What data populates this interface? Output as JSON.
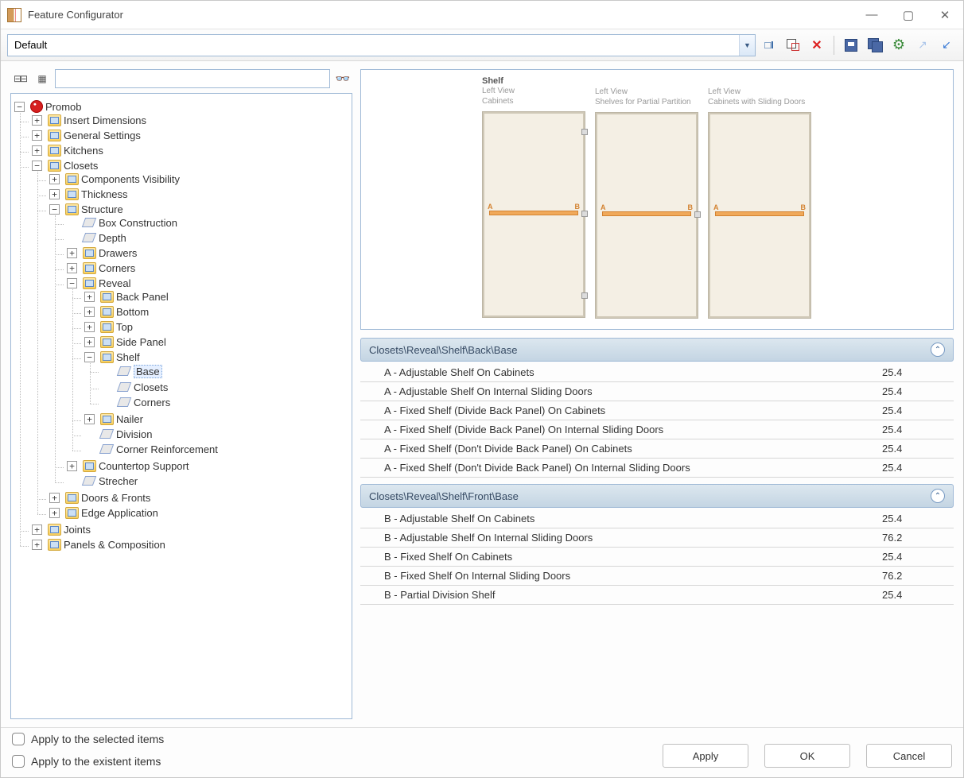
{
  "window": {
    "title": "Feature Configurator"
  },
  "toolbar": {
    "preset_value": "Default"
  },
  "search": {
    "placeholder": ""
  },
  "tree": {
    "root": "Promob",
    "items": {
      "insert_dimensions": "Insert Dimensions",
      "general_settings": "General Settings",
      "kitchens": "Kitchens",
      "closets": "Closets",
      "components_visibility": "Components Visibility",
      "thickness": "Thickness",
      "structure": "Structure",
      "box_construction": "Box Construction",
      "depth": "Depth",
      "drawers": "Drawers",
      "corners": "Corners",
      "reveal": "Reveal",
      "back_panel": "Back Panel",
      "bottom": "Bottom",
      "top": "Top",
      "side_panel": "Side Panel",
      "shelf": "Shelf",
      "base": "Base",
      "shelf_closets": "Closets",
      "shelf_corners": "Corners",
      "nailer": "Nailer",
      "division": "Division",
      "corner_reinforcement": "Corner Reinforcement",
      "countertop_support": "Countertop Support",
      "strecher": "Strecher",
      "doors_fronts": "Doors & Fronts",
      "edge_application": "Edge Application",
      "joints": "Joints",
      "panels_composition": "Panels & Composition"
    }
  },
  "preview": {
    "title": "Shelf",
    "col1_line1": "Left View",
    "col1_line2": "Cabinets",
    "col2_line1": "Left View",
    "col2_line2": "Shelves for Partial Partition",
    "col3_line1": "Left View",
    "col3_line2": "Cabinets with Sliding Doors"
  },
  "groups": [
    {
      "title": "Closets\\Reveal\\Shelf\\Back\\Base",
      "rows": [
        {
          "label": "A - Adjustable Shelf On Cabinets",
          "value": "25.4"
        },
        {
          "label": "A - Adjustable Shelf On Internal Sliding Doors",
          "value": "25.4"
        },
        {
          "label": "A - Fixed Shelf (Divide Back Panel) On Cabinets",
          "value": "25.4"
        },
        {
          "label": "A - Fixed Shelf (Divide Back Panel) On Internal Sliding Doors",
          "value": "25.4"
        },
        {
          "label": "A - Fixed Shelf (Don't Divide Back Panel) On Cabinets",
          "value": "25.4"
        },
        {
          "label": "A - Fixed Shelf (Don't Divide Back Panel) On Internal Sliding Doors",
          "value": "25.4"
        }
      ]
    },
    {
      "title": "Closets\\Reveal\\Shelf\\Front\\Base",
      "rows": [
        {
          "label": "B - Adjustable Shelf On Cabinets",
          "value": "25.4"
        },
        {
          "label": "B - Adjustable Shelf On Internal Sliding Doors",
          "value": "76.2"
        },
        {
          "label": "B - Fixed Shelf On Cabinets",
          "value": "25.4"
        },
        {
          "label": "B - Fixed Shelf On Internal Sliding Doors",
          "value": "76.2"
        },
        {
          "label": "B - Partial Division Shelf",
          "value": "25.4"
        }
      ]
    }
  ],
  "footer": {
    "apply_selected": "Apply to the selected items",
    "apply_existent": "Apply to the existent items",
    "btn_apply": "Apply",
    "btn_ok": "OK",
    "btn_cancel": "Cancel"
  }
}
